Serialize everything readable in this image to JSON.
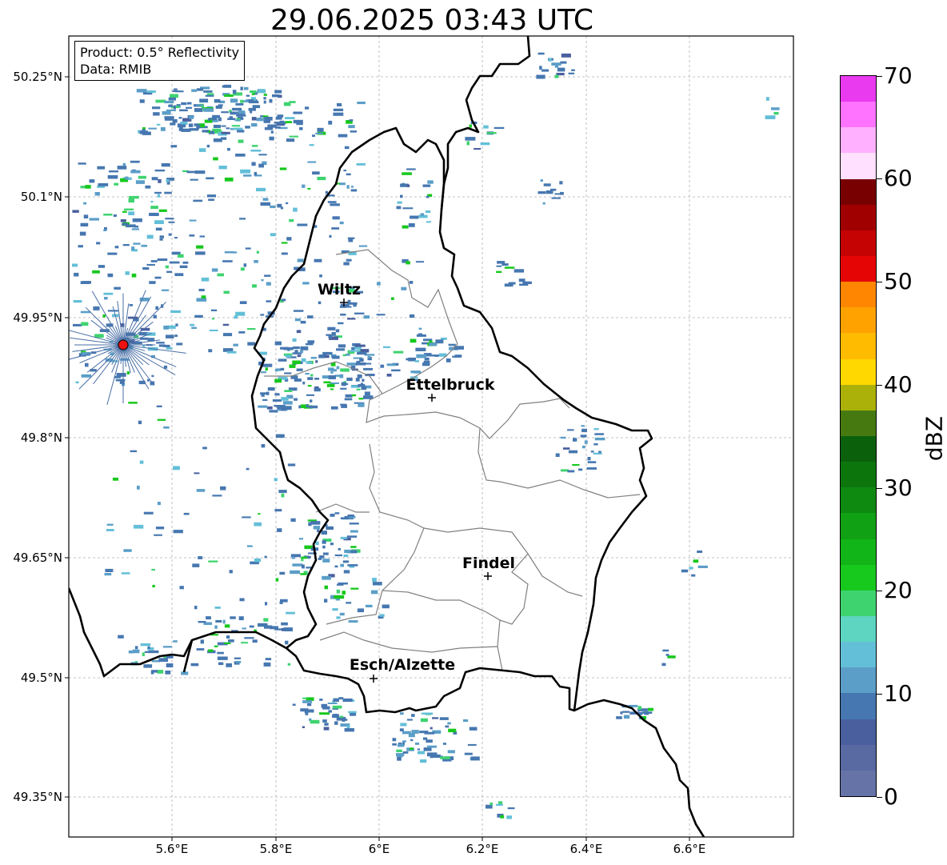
{
  "title": "29.06.2025 03:43 UTC",
  "info": {
    "product": "Product: 0.5° Reflectivity",
    "data": "Data: RMIB"
  },
  "axes": {
    "lat_ticks": [
      "50.25°N",
      "50.1°N",
      "49.95°N",
      "49.8°N",
      "49.65°N",
      "49.5°N",
      "49.35°N"
    ],
    "lon_ticks": [
      "5.6°E",
      "5.8°E",
      "6°E",
      "6.2°E",
      "6.4°E",
      "6.6°E"
    ]
  },
  "cities": [
    {
      "name": "Wiltz"
    },
    {
      "name": "Ettelbruck"
    },
    {
      "name": "Findel"
    },
    {
      "name": "Esch/Alzette"
    }
  ],
  "colorbar": {
    "unit": "dBZ",
    "min": 0,
    "max": 70,
    "tick_labels": [
      "0",
      "10",
      "20",
      "30",
      "40",
      "50",
      "60",
      "70"
    ],
    "colors": [
      "#6573a7",
      "#5969a2",
      "#4a5f9e",
      "#4677b0",
      "#5b9ec8",
      "#63bfd8",
      "#5dd5c1",
      "#3fd36f",
      "#17c81d",
      "#12b517",
      "#11a114",
      "#0e8a11",
      "#0c760d",
      "#0b600c",
      "#467a10",
      "#abb109",
      "#ffd800",
      "#ffbb00",
      "#ffa200",
      "#ff8600",
      "#e60505",
      "#c50303",
      "#a00000",
      "#780000",
      "#ffe0ff",
      "#ffb1ff",
      "#ff73ff",
      "#e93af0"
    ]
  },
  "radar_site_color": "#ee1111",
  "colors": {
    "border": "#000000",
    "cantons": "#808080",
    "grid": "#aaaaaa"
  }
}
